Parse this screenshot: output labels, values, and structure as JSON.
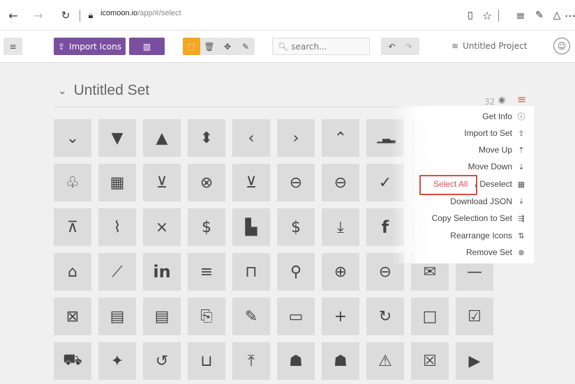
{
  "browser": {
    "url_domain": "icomoon.io",
    "url_path": "/app/#/select"
  },
  "toolbar": {
    "import_label": "Import Icons",
    "search_placeholder": "search...",
    "project_name": "Untitled Project"
  },
  "set": {
    "title": "Untitled Set",
    "count": "32"
  },
  "menu": {
    "items": [
      {
        "label": "Get Info",
        "icon": "info-icon"
      },
      {
        "label": "Import to Set",
        "icon": "import-icon"
      },
      {
        "label": "Move Up",
        "icon": "move-up-icon"
      },
      {
        "label": "Move Down",
        "icon": "move-down-icon"
      },
      {
        "label_a": "Select All",
        "sep": " / ",
        "label_b": "Deselect",
        "icon": "select-icon"
      },
      {
        "label": "Download JSON",
        "icon": "download-icon"
      },
      {
        "label": "Copy Selection to Set",
        "icon": "copy-icon"
      },
      {
        "label": "Rearrange Icons",
        "icon": "rearrange-icon"
      },
      {
        "label": "Remove Set",
        "icon": "remove-icon"
      }
    ]
  },
  "icons": [
    [
      "chevron-down",
      "triangle-down",
      "triangle-up",
      "sort",
      "chevron-left",
      "chevron-right",
      "chevron-up",
      "bar-chart",
      "trash",
      "hidden-under-menu"
    ],
    [
      "lightbulb",
      "calendar",
      "cart",
      "circle-x",
      "circle-down",
      "circle-left",
      "circle-minus",
      "circle-check",
      "circle-blank",
      "hidden-under-menu"
    ],
    [
      "circle-up",
      "paperclip",
      "close",
      "dollar-circle",
      "file",
      "file-dollar",
      "download",
      "facebook",
      "google-plus",
      "question"
    ],
    [
      "home",
      "line-chart",
      "linkedin",
      "menu",
      "lock",
      "search",
      "zoom-in",
      "zoom-out",
      "mail",
      "minus"
    ],
    [
      "image-x",
      "newspaper",
      "newspaper-add",
      "file-pdf",
      "pencil",
      "image",
      "plus",
      "refresh",
      "checkbox-blank",
      "checkbox-checked"
    ],
    [
      "truck",
      "twitter",
      "undo",
      "unlock",
      "upload",
      "user",
      "user-add",
      "warning",
      "file-excel",
      "youtube"
    ]
  ],
  "accent": {
    "purple": "#7b4fa0",
    "orange": "#f5a623",
    "red": "#e0524f"
  }
}
